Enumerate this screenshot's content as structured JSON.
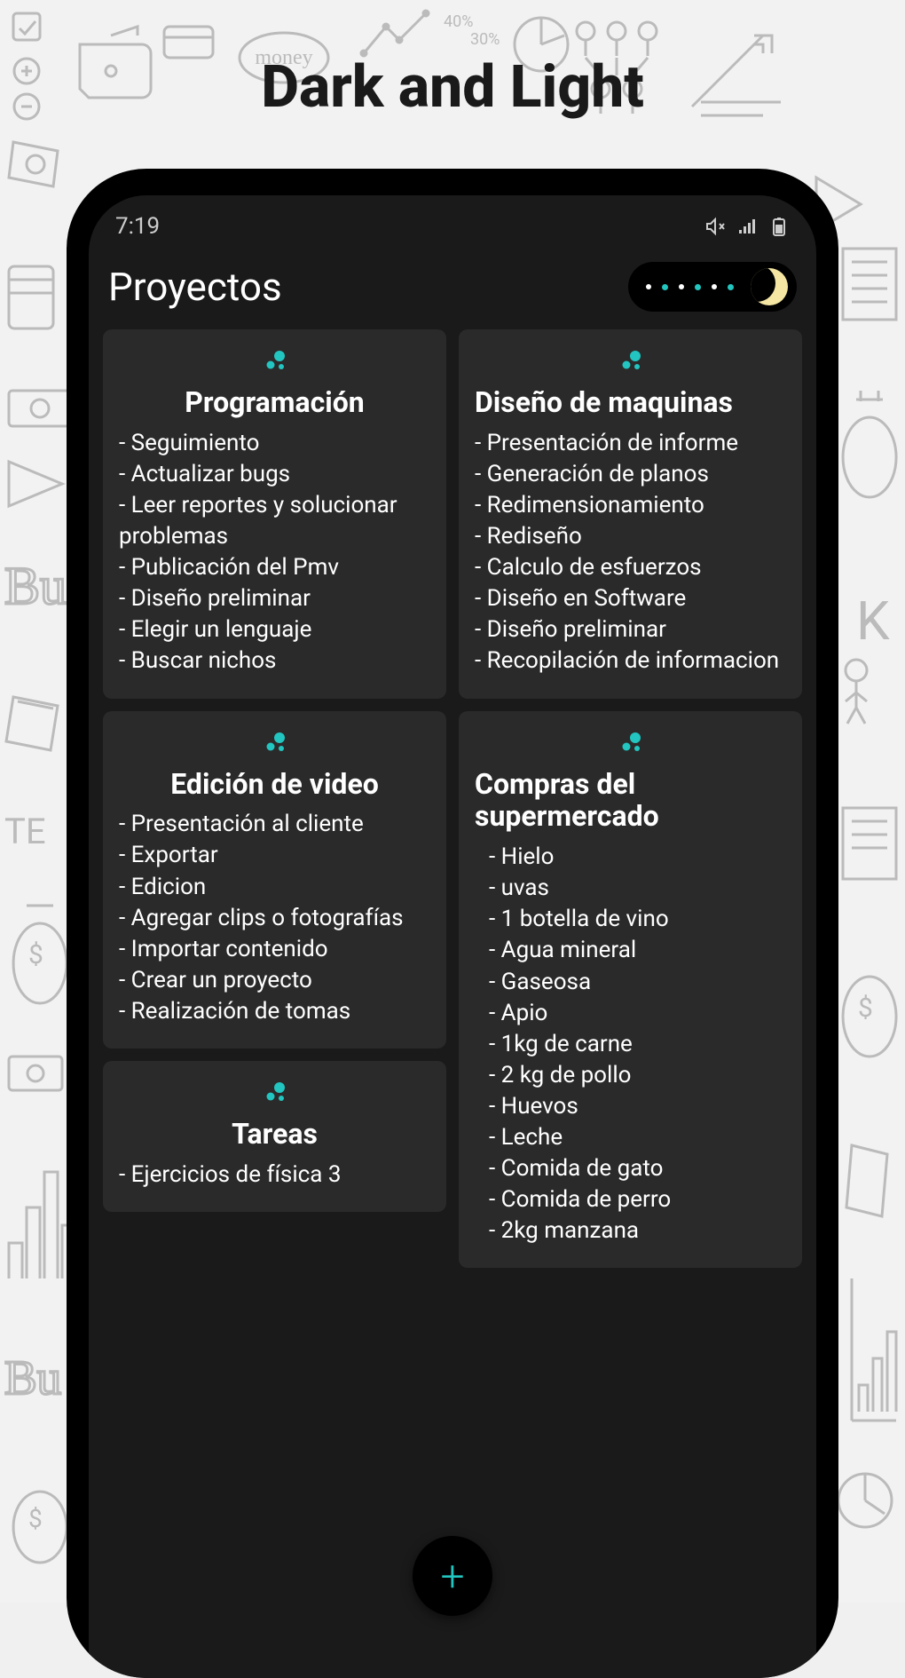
{
  "hero": {
    "title": "Dark and Light"
  },
  "status": {
    "time": "7:19"
  },
  "header": {
    "title": "Proyectos"
  },
  "fab": {
    "label": "+"
  },
  "cards": {
    "programacion": {
      "title": "Programación",
      "items": [
        "Seguimiento",
        "Actualizar bugs",
        "Leer reportes y solucionar problemas",
        "Publicación del Pmv",
        "Diseño preliminar",
        "Elegir un lenguaje",
        "Buscar nichos"
      ]
    },
    "maquinas": {
      "title": "Diseño de maquinas",
      "items": [
        "Presentación de informe",
        "Generación de planos",
        "Redimensionamiento",
        "Rediseño",
        "Calculo de esfuerzos",
        "Diseño en Software",
        "Diseño preliminar",
        "Recopilación de informacion"
      ]
    },
    "video": {
      "title": "Edición de video",
      "items": [
        "Presentación al cliente",
        "Exportar",
        "Edicion",
        "Agregar clips o fotografías",
        "Importar contenido",
        "Crear un proyecto",
        "Realización de tomas"
      ]
    },
    "compras": {
      "title": "Compras del supermercado",
      "items": [
        "Hielo",
        "uvas",
        "1 botella de vino",
        "Agua mineral",
        "Gaseosa",
        "Apio",
        "1kg  de carne",
        "2 kg de pollo",
        "Huevos",
        "Leche",
        "Comida de gato",
        "Comida de perro",
        "2kg manzana"
      ]
    },
    "tareas": {
      "title": "Tareas",
      "items": [
        "Ejercicios de física 3"
      ]
    }
  }
}
